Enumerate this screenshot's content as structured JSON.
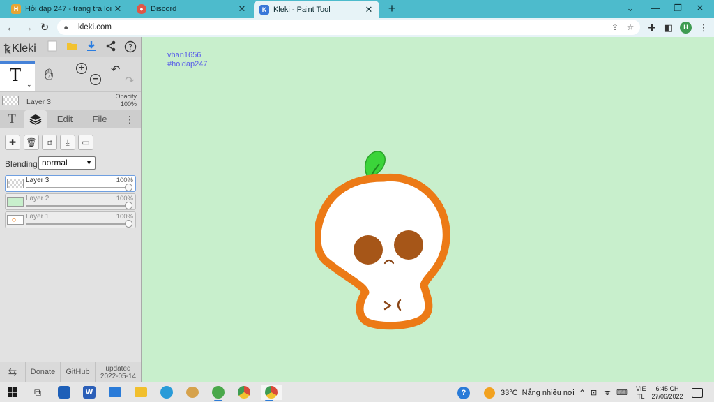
{
  "browser": {
    "tabs": [
      {
        "title": "Hỏi đáp 247 - trang tra loi",
        "icon": "hoidap-favicon",
        "color": "#e8a534"
      },
      {
        "title": "Discord",
        "icon": "discord-favicon",
        "color": "#e05646"
      },
      {
        "title": "Kleki - Paint Tool",
        "icon": "kleki-favicon",
        "color": "#3a77d8"
      }
    ],
    "url": "kleki.com",
    "profile_initial": "H"
  },
  "kleki": {
    "logo_text": "Kleki",
    "current_layer": {
      "name": "Layer 3",
      "opacity_label": "Opacity",
      "opacity_value": "100%"
    },
    "tabs": {
      "edit": "Edit",
      "file": "File"
    },
    "blending": {
      "label": "Blending",
      "value": "normal"
    },
    "layers": [
      {
        "name": "Layer 3",
        "opacity": "100%",
        "active": true
      },
      {
        "name": "Layer 2",
        "opacity": "100%",
        "active": false
      },
      {
        "name": "Layer 1",
        "opacity": "100%",
        "active": false
      }
    ],
    "footer": {
      "donate": "Donate",
      "github": "GitHub",
      "updated_label": "updated",
      "updated_date": "2022-05-14"
    }
  },
  "canvas": {
    "text_lines": [
      "vhan1656",
      "#hoidap247"
    ],
    "background": "#c8efcc",
    "drawing": {
      "outline_color": "#ec7a16",
      "leaf_color": "#3bd43a",
      "eye_color": "#a65618"
    }
  },
  "taskbar": {
    "weather_temp": "33°C",
    "weather_text": "Nắng nhiều nơi",
    "lang_top": "VIE",
    "lang_bottom": "TL",
    "time": "6:45 CH",
    "date": "27/06/2022"
  }
}
